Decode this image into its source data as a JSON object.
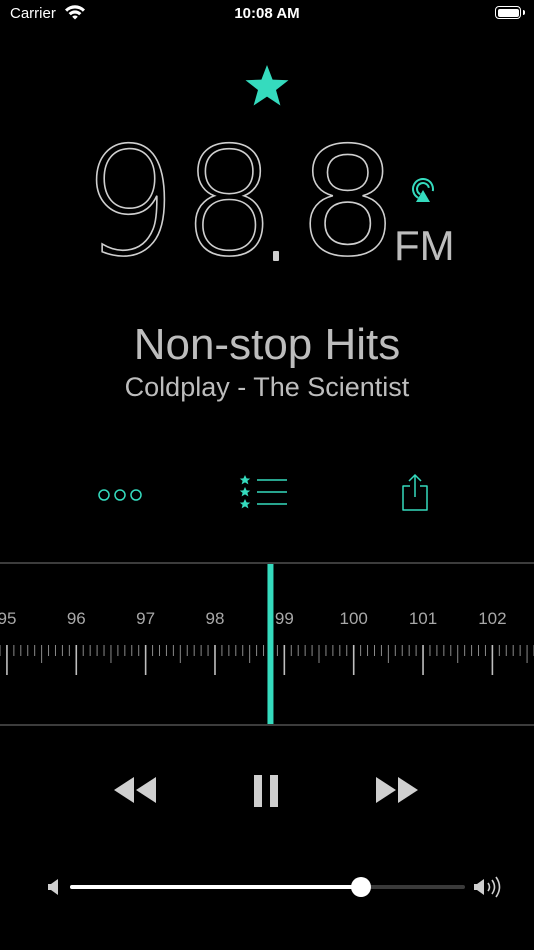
{
  "status_bar": {
    "carrier": "Carrier",
    "time": "10:08 AM",
    "battery_level": 1.0
  },
  "accent_color": "#35dbbe",
  "favorite": {
    "icon": "star-icon",
    "active": true
  },
  "tuner": {
    "frequency_integer": "98",
    "frequency_decimal": "8",
    "band": "FM",
    "current_frequency": 98.8,
    "labels": [
      "95",
      "96",
      "97",
      "98",
      "99",
      "100",
      "101",
      "102"
    ],
    "range": [
      94.9,
      102.6
    ]
  },
  "station": {
    "name": "Non-stop Hits",
    "now_playing": "Coldplay - The Scientist"
  },
  "toolbar": {
    "more_icon": "more-dots-icon",
    "list_icon": "favorites-list-icon",
    "share_icon": "share-icon"
  },
  "playback": {
    "rewind_icon": "rewind-icon",
    "pause_icon": "pause-icon",
    "forward_icon": "fast-forward-icon"
  },
  "volume": {
    "level": 0.737
  }
}
